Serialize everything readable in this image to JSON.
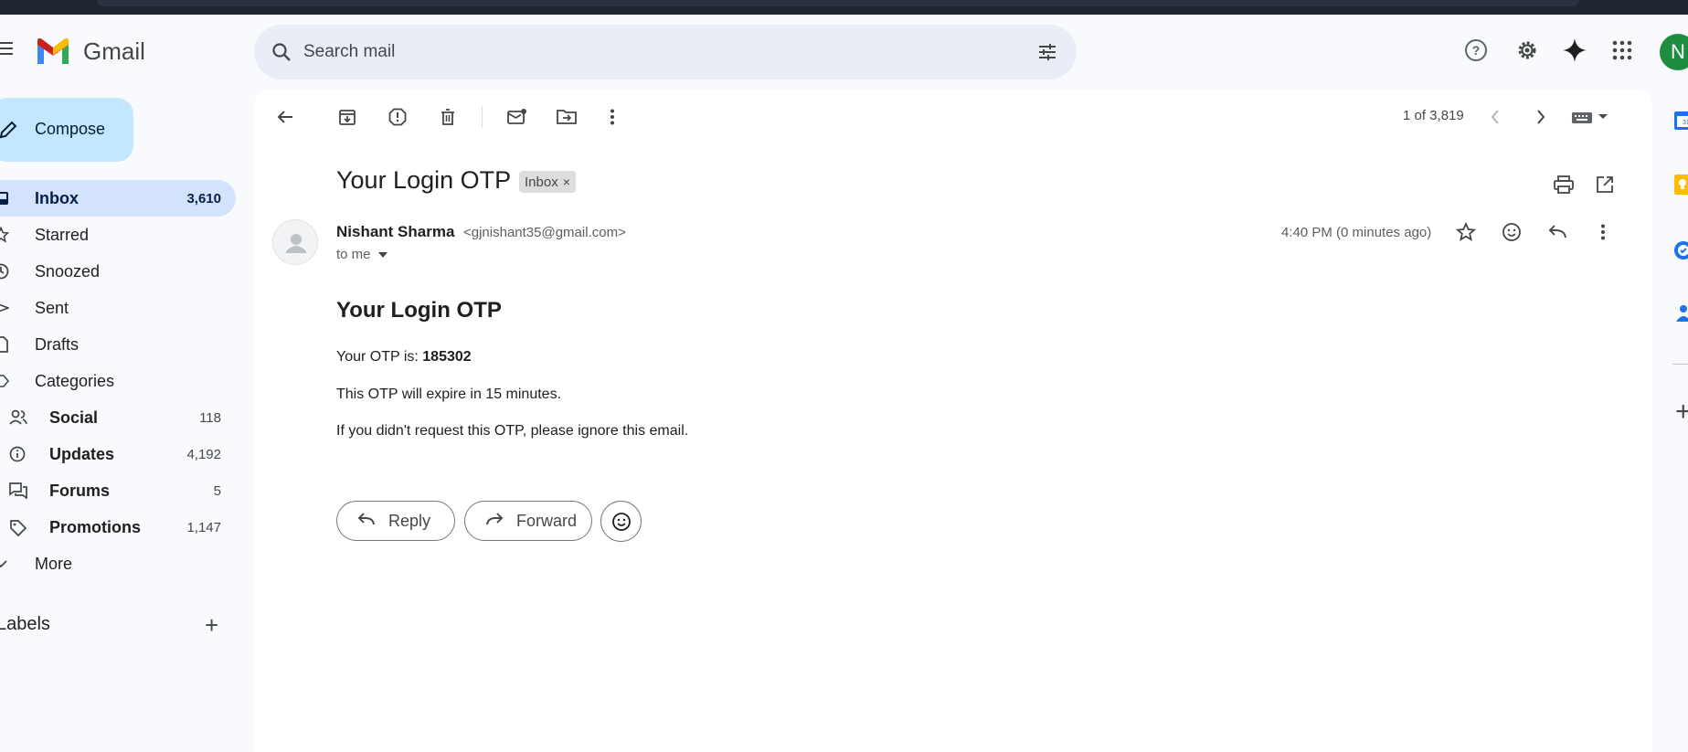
{
  "app": {
    "brand": "Gmail",
    "search_placeholder": "Search mail",
    "avatar_initial": "N"
  },
  "sidebar": {
    "compose_label": "Compose",
    "items": [
      {
        "label": "Inbox",
        "count": "3,610",
        "icon": "inbox-icon",
        "active": true
      },
      {
        "label": "Starred",
        "count": "",
        "icon": "star-icon"
      },
      {
        "label": "Snoozed",
        "count": "",
        "icon": "clock-icon"
      },
      {
        "label": "Sent",
        "count": "",
        "icon": "send-icon"
      },
      {
        "label": "Drafts",
        "count": "",
        "icon": "draft-icon"
      },
      {
        "label": "Categories",
        "count": "",
        "icon": "label-icon"
      },
      {
        "label": "Social",
        "count": "118",
        "icon": "people-icon",
        "sub": true
      },
      {
        "label": "Updates",
        "count": "4,192",
        "icon": "info-icon",
        "sub": true
      },
      {
        "label": "Forums",
        "count": "5",
        "icon": "forum-icon",
        "sub": true
      },
      {
        "label": "Promotions",
        "count": "1,147",
        "icon": "tag-icon",
        "sub": true
      },
      {
        "label": "More",
        "count": "",
        "icon": "chevron-down-icon"
      }
    ],
    "labels_heading": "Labels",
    "labels_add": "+"
  },
  "toolbar": {
    "pager_text": "1 of 3,819"
  },
  "email": {
    "subject": "Your Login OTP",
    "label_chip": "Inbox",
    "label_chip_close": "×",
    "sender_name": "Nishant Sharma",
    "sender_email": "<gjnishant35@gmail.com>",
    "recipient": "to me",
    "timestamp": "4:40 PM (0 minutes ago)",
    "body_title": "Your Login OTP",
    "otp_prefix": "Your OTP is:",
    "otp_code": "185302",
    "expiry_line": "This OTP will expire in 15 minutes.",
    "ignore_line": "If you didn't request this OTP, please ignore this email."
  },
  "actions": {
    "reply_label": "Reply",
    "forward_label": "Forward"
  },
  "colors": {
    "accent_compose": "#c2e7ff",
    "active_nav": "#d3e3fd",
    "avatar_bg": "#1e8e3e"
  }
}
